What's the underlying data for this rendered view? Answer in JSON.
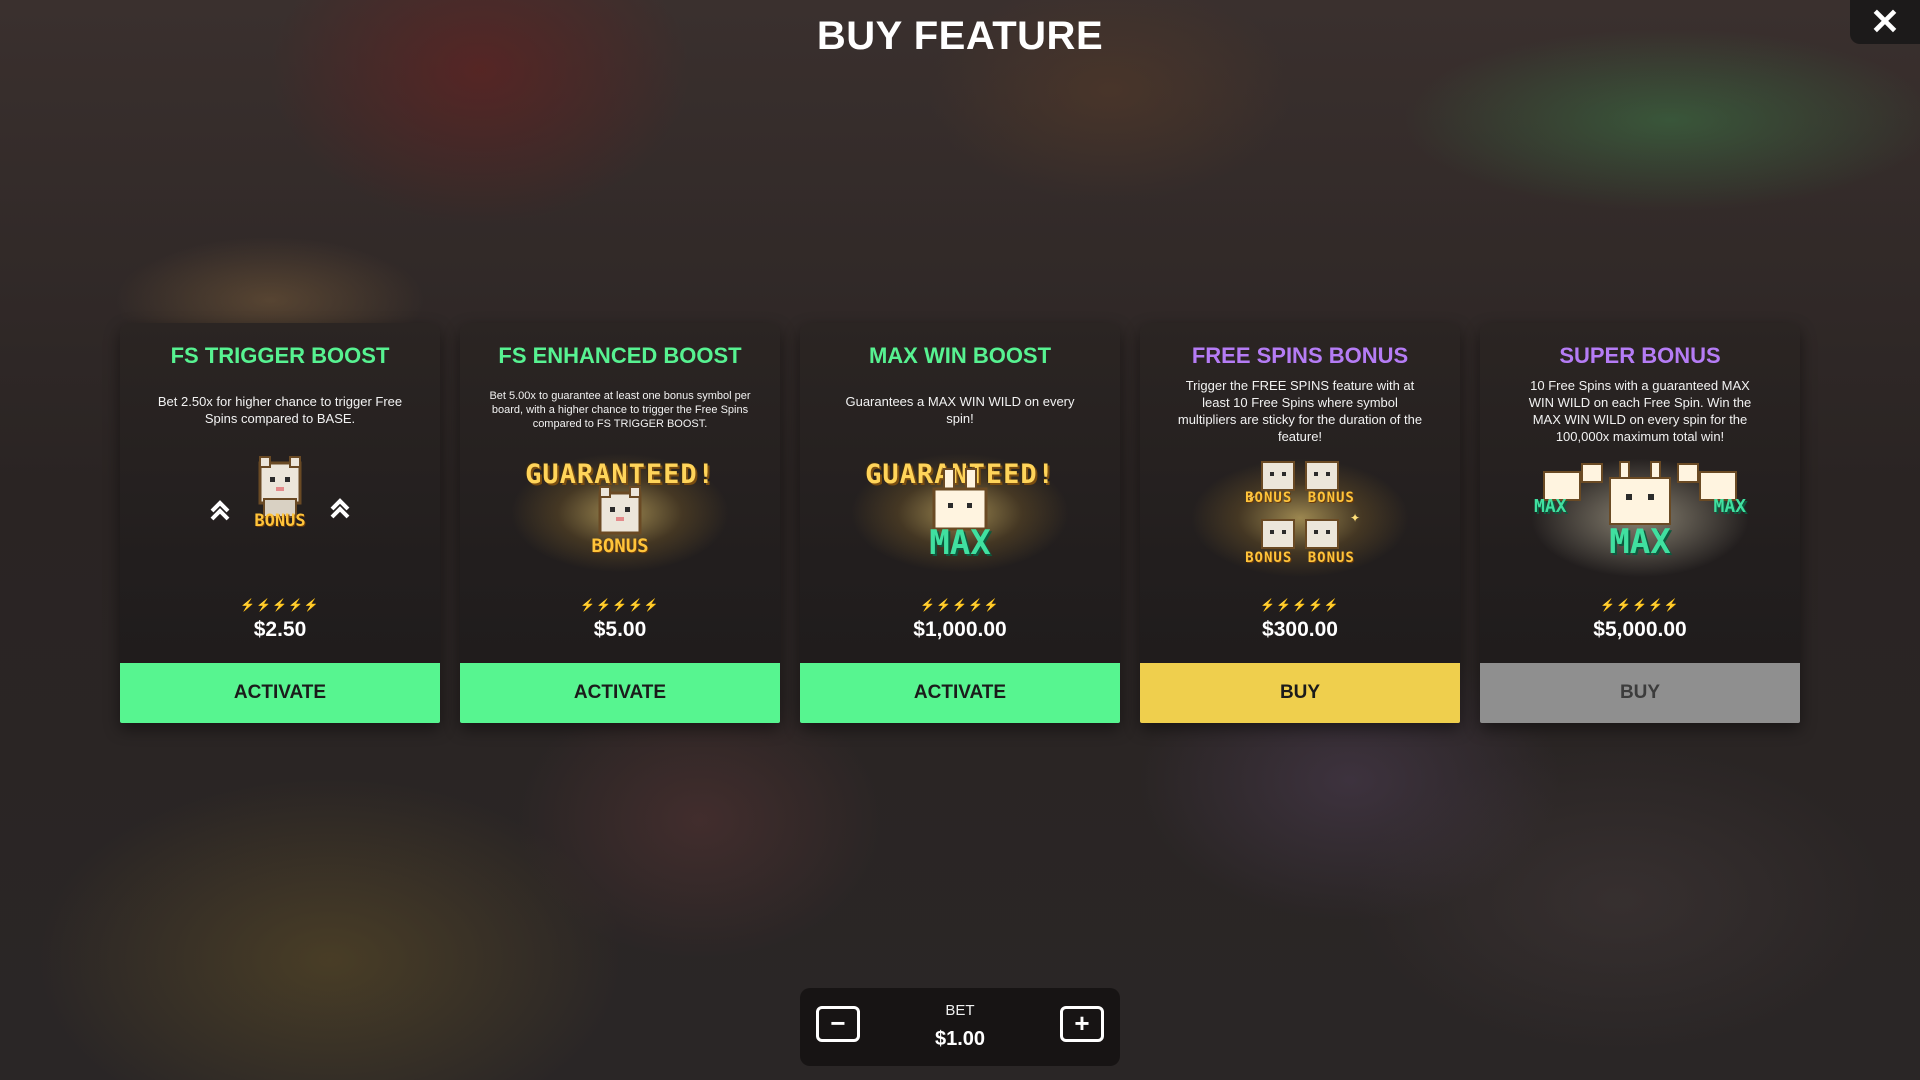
{
  "header": {
    "title": "BUY FEATURE",
    "close_icon": "close-icon"
  },
  "colors": {
    "green_title": "#57f291",
    "purple_title": "#b57cf5",
    "activate": "#57f590",
    "buy": "#efcf4d",
    "buy_disabled": "#8f8f8f"
  },
  "cards": [
    {
      "title": "FS TRIGGER BOOST",
      "description": "Bet 2.50x for higher chance to trigger Free Spins compared to BASE.",
      "art_bonus": "BONUS",
      "volatility_level": 2,
      "volatility_max": 5,
      "price": "$2.50",
      "action": "ACTIVATE",
      "enabled": true
    },
    {
      "title": "FS ENHANCED BOOST",
      "description": "Bet 5.00x to guarantee at least one bonus symbol per board, with a higher chance to trigger the Free Spins compared to FS TRIGGER BOOST.",
      "art_banner": "GUARANTEED!",
      "art_bonus": "BONUS",
      "volatility_level": 3,
      "volatility_max": 5,
      "price": "$5.00",
      "action": "ACTIVATE",
      "enabled": true
    },
    {
      "title": "MAX WIN BOOST",
      "description": "Guarantees a MAX WIN WILD on every spin!",
      "art_banner": "GUARANTEED!",
      "art_max": "MAX",
      "volatility_level": 5,
      "volatility_max": 5,
      "price": "$1,000.00",
      "action": "ACTIVATE",
      "enabled": true
    },
    {
      "title": "FREE SPINS BONUS",
      "description": "Trigger the FREE SPINS feature with at least 10 Free Spins where symbol multipliers are sticky for the duration of the feature!",
      "art_bonus": "BONUS",
      "volatility_level": 4,
      "volatility_max": 5,
      "price": "$300.00",
      "action": "BUY",
      "enabled": true
    },
    {
      "title": "SUPER BONUS",
      "description": "10 Free Spins with a guaranteed MAX WIN WILD on each Free Spin. Win the MAX WIN WILD on every spin for the 100,000x maximum total win!",
      "art_max": "MAX",
      "volatility_level": 5,
      "volatility_max": 5,
      "price": "$5,000.00",
      "action": "BUY",
      "enabled": false
    }
  ],
  "bet": {
    "label": "BET",
    "value": "$1.00",
    "minus_icon": "minus-icon",
    "plus_icon": "plus-icon"
  }
}
